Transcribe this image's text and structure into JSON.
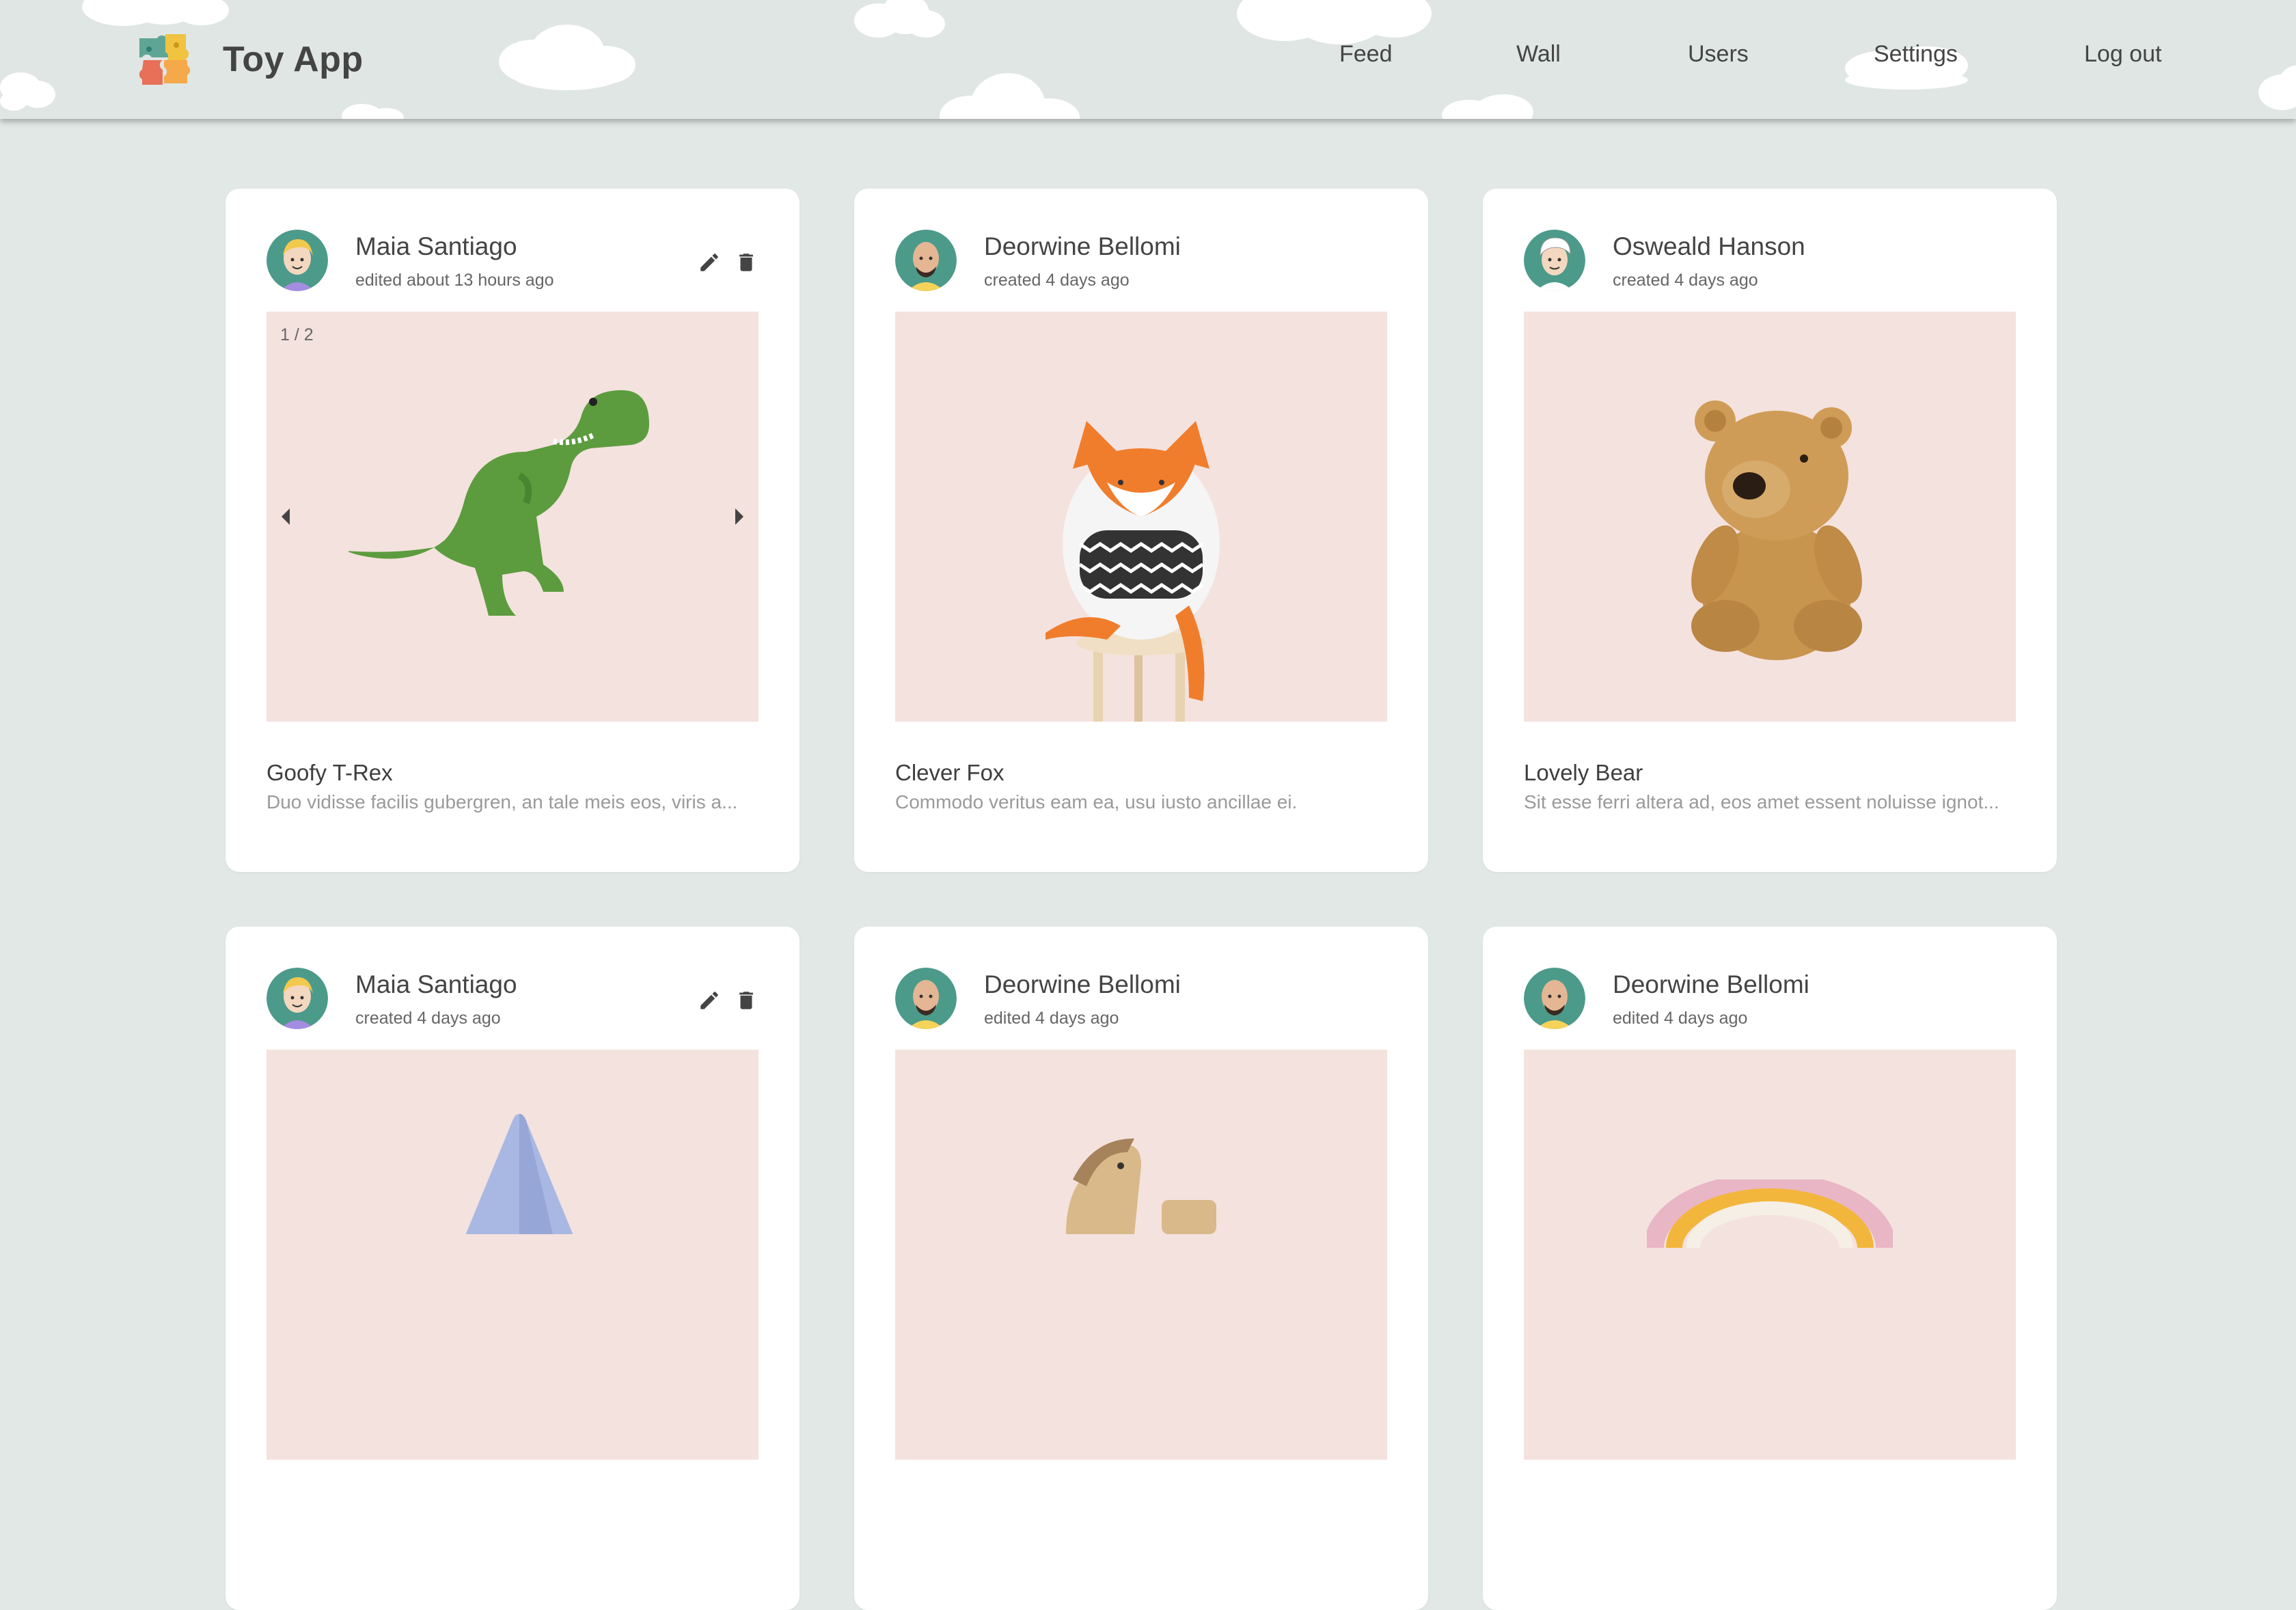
{
  "app": {
    "title": "Toy App"
  },
  "nav": {
    "items": [
      {
        "label": "Feed"
      },
      {
        "label": "Wall"
      },
      {
        "label": "Users"
      },
      {
        "label": "Settings"
      },
      {
        "label": "Log out"
      }
    ]
  },
  "posts": [
    {
      "author": "Maia Santiago",
      "timestamp": "edited about 13 hours ago",
      "own_post": true,
      "image_counter": "1 / 2",
      "image": "green-dinosaur-toy",
      "title": "Goofy T-Rex",
      "description": "Duo vidisse facilis gubergren, an tale meis eos, viris a..."
    },
    {
      "author": "Deorwine Bellomi",
      "timestamp": "created 4 days ago",
      "own_post": false,
      "image": "fox-plush-on-stool",
      "title": "Clever Fox",
      "description": "Commodo veritus eam ea, usu iusto ancillae ei."
    },
    {
      "author": "Osweald Hanson",
      "timestamp": "created 4 days ago",
      "own_post": false,
      "image": "teddy-bear",
      "title": "Lovely Bear",
      "description": "Sit esse ferri altera ad, eos amet essent noluisse ignot..."
    },
    {
      "author": "Maia Santiago",
      "timestamp": "created 4 days ago",
      "own_post": true,
      "image": "blue-cone-toy"
    },
    {
      "author": "Deorwine Bellomi",
      "timestamp": "edited 4 days ago",
      "own_post": false,
      "image": "wooden-rocking-horse"
    },
    {
      "author": "Deorwine Bellomi",
      "timestamp": "edited 4 days ago",
      "own_post": false,
      "image": "rainbow-pillow"
    }
  ],
  "icons": {
    "logo": "puzzle-logo-icon",
    "edit": "pencil-icon",
    "delete": "trash-icon",
    "prev": "chevron-left-icon",
    "next": "chevron-right-icon"
  },
  "colors": {
    "background": "#e1e8e5",
    "header": "#dfe6e3",
    "card": "#ffffff",
    "image_background": "#f4e2de",
    "avatar_ring": "#4c9a8a"
  }
}
